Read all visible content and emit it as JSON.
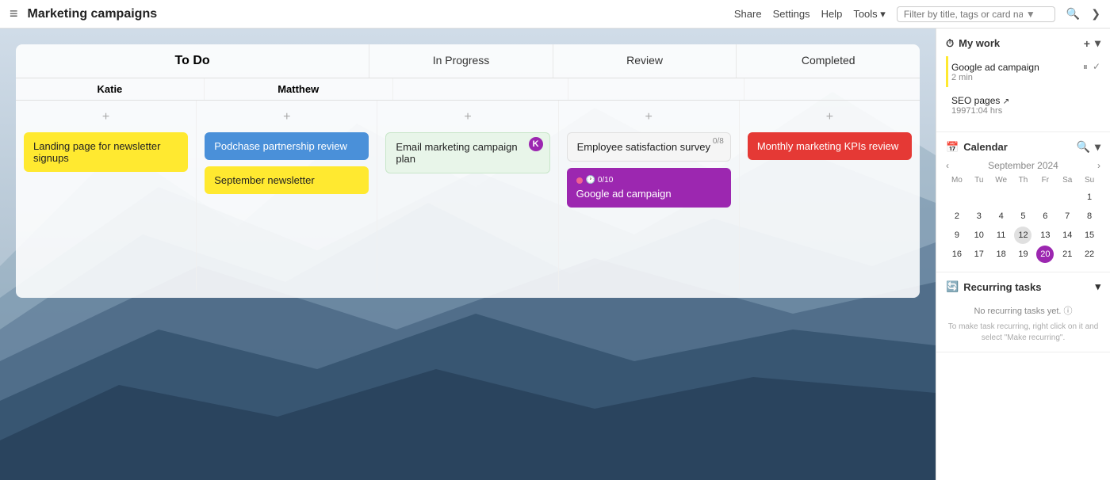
{
  "topbar": {
    "menu_icon": "≡",
    "title": "Marketing campaigns",
    "share": "Share",
    "settings": "Settings",
    "help": "Help",
    "tools": "Tools",
    "tools_arrow": "▾",
    "search_placeholder": "Filter by title, tags or card name",
    "expand_icon": "❯"
  },
  "board": {
    "main_header": "To Do",
    "column_headers": [
      "",
      "In Progress",
      "Review",
      "Completed"
    ],
    "sub_headers": [
      "Katie",
      "Matthew",
      "",
      "",
      ""
    ],
    "columns": [
      {
        "name": "katie",
        "cards": [
          {
            "id": "c1",
            "text": "Landing page for newsletter signups",
            "color": "yellow",
            "badge": null
          }
        ]
      },
      {
        "name": "matthew",
        "cards": [
          {
            "id": "c2",
            "text": "Podchase partnership review",
            "color": "blue",
            "badge": null
          },
          {
            "id": "c3",
            "text": "September newsletter",
            "color": "yellow",
            "badge": null
          }
        ]
      },
      {
        "name": "in_progress",
        "cards": [
          {
            "id": "c4",
            "text": "Email marketing campaign plan",
            "color": "green",
            "badge": "K",
            "badge_pos": "top-right"
          }
        ]
      },
      {
        "name": "review",
        "cards": [
          {
            "id": "c5",
            "text": "Employee satisfaction survey",
            "color": "light",
            "progress": "0/8",
            "badge": null
          },
          {
            "id": "c6",
            "text": "Google ad campaign",
            "color": "purple",
            "sub_progress": "0/10",
            "sub_dot": true
          }
        ]
      },
      {
        "name": "completed",
        "cards": [
          {
            "id": "c7",
            "text": "Monthly marketing KPIs review",
            "color": "red",
            "badge": null
          }
        ]
      }
    ]
  },
  "right_panel": {
    "mywork": {
      "title": "My work",
      "add_icon": "+",
      "items": [
        {
          "title": "Google ad campaign",
          "subtitle": "2 min",
          "active": true,
          "pause_icon": "⏸",
          "check_icon": "✓"
        },
        {
          "title": "SEO pages",
          "link": true,
          "subtitle": "19971:04 hrs"
        }
      ]
    },
    "calendar": {
      "title": "Calendar",
      "search_icon": "🔍",
      "collapse_icon": "▾",
      "prev": "‹",
      "next": "›",
      "month_year": "September 2024",
      "day_headers": [
        "Mo",
        "Tu",
        "We",
        "Th",
        "Fr",
        "Sa",
        "Su"
      ],
      "weeks": [
        [
          "",
          "",
          "",
          "",
          "",
          "",
          "1"
        ],
        [
          "2",
          "3",
          "4",
          "5",
          "6",
          "7",
          "8"
        ],
        [
          "9",
          "10",
          "11",
          "12",
          "13",
          "14",
          "15"
        ],
        [
          "16",
          "17",
          "18",
          "19",
          "20",
          "21",
          "22"
        ]
      ],
      "highlighted_day": "12",
      "today": "20"
    },
    "recurring": {
      "title": "Recurring tasks",
      "collapse_icon": "▾",
      "empty_text": "No recurring tasks yet.",
      "hint": "To make task recurring, right click on it and select \"Make recurring\"."
    }
  }
}
